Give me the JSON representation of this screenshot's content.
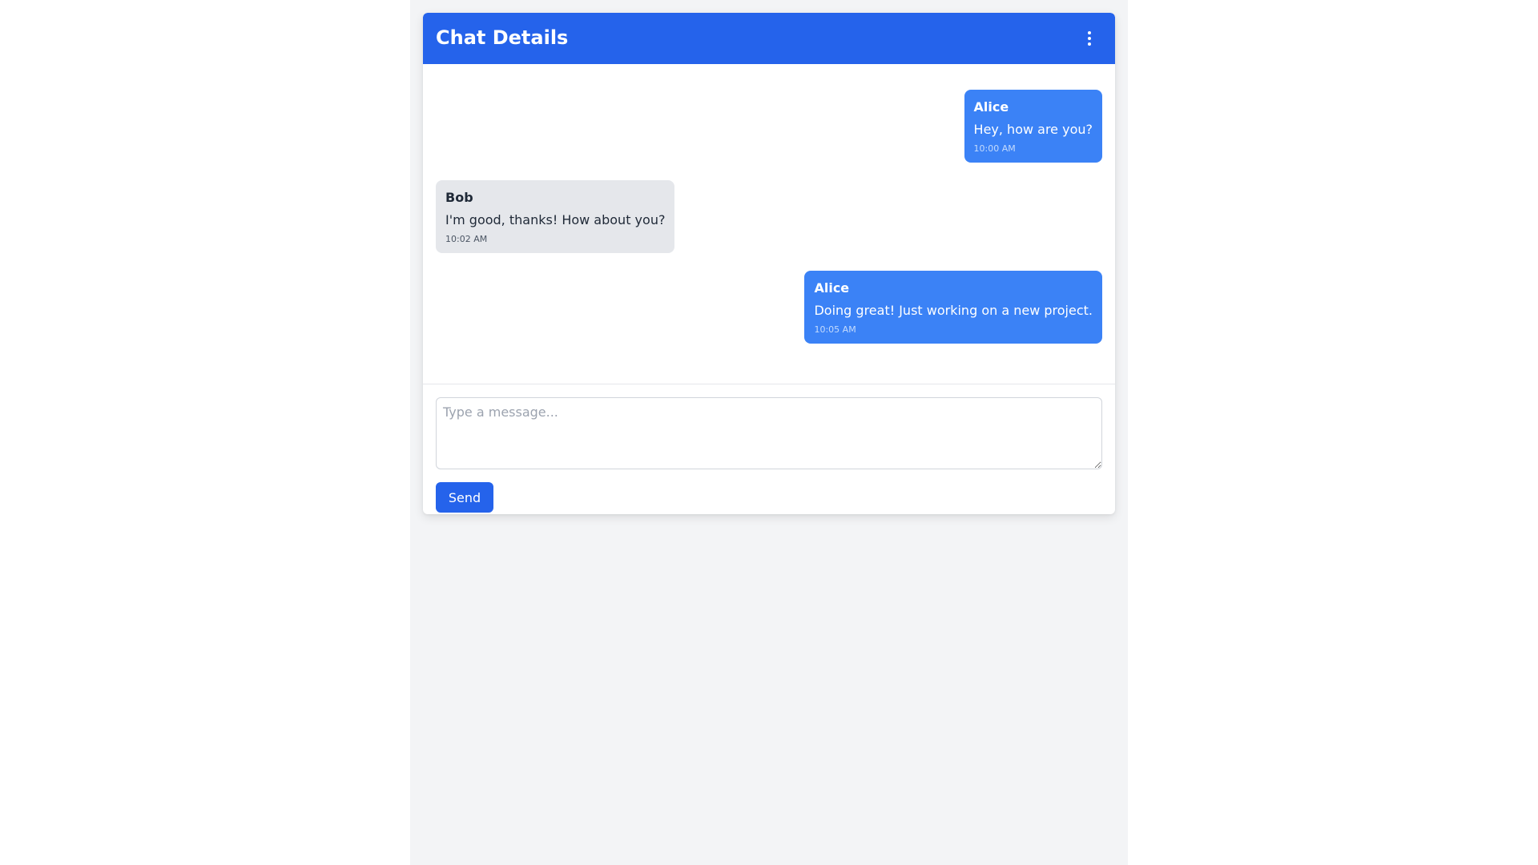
{
  "header": {
    "title": "Chat Details",
    "menu_icon": "more-vertical-icon"
  },
  "messages": [
    {
      "sender": "Alice",
      "text": "Hey, how are you?",
      "time": "10:00 AM",
      "direction": "sent"
    },
    {
      "sender": "Bob",
      "text": "I'm good, thanks! How about you?",
      "time": "10:02 AM",
      "direction": "received"
    },
    {
      "sender": "Alice",
      "text": "Doing great! Just working on a new project.",
      "time": "10:05 AM",
      "direction": "sent"
    }
  ],
  "composer": {
    "placeholder": "Type a message...",
    "value": "",
    "send_label": "Send"
  },
  "colors": {
    "header": "#2563eb",
    "sent_bubble": "#3b82f6",
    "received_bubble": "#e5e7eb",
    "page_background": "#f3f4f6",
    "send_button": "#2563eb"
  }
}
